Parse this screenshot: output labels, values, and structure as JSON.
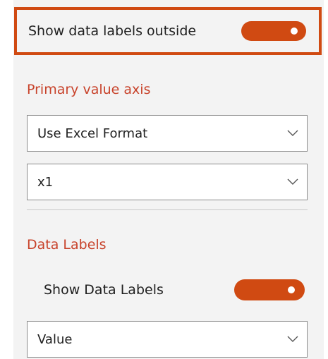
{
  "labels_outside": {
    "label": "Show data labels outside",
    "toggle_on": true
  },
  "primary_value_axis": {
    "title": "Primary value axis",
    "format_select": {
      "value": "Use Excel Format"
    },
    "scale_select": {
      "value": "x1"
    }
  },
  "data_labels": {
    "title": "Data Labels",
    "show_label": "Show Data Labels",
    "show_toggle_on": true,
    "content_select": {
      "value": "Value"
    }
  },
  "colors": {
    "accent": "#d04a12",
    "section_title": "#c8432b",
    "panel_bg": "#f3f3f3"
  },
  "icons": {
    "dropdown": "chevron-down-icon"
  }
}
